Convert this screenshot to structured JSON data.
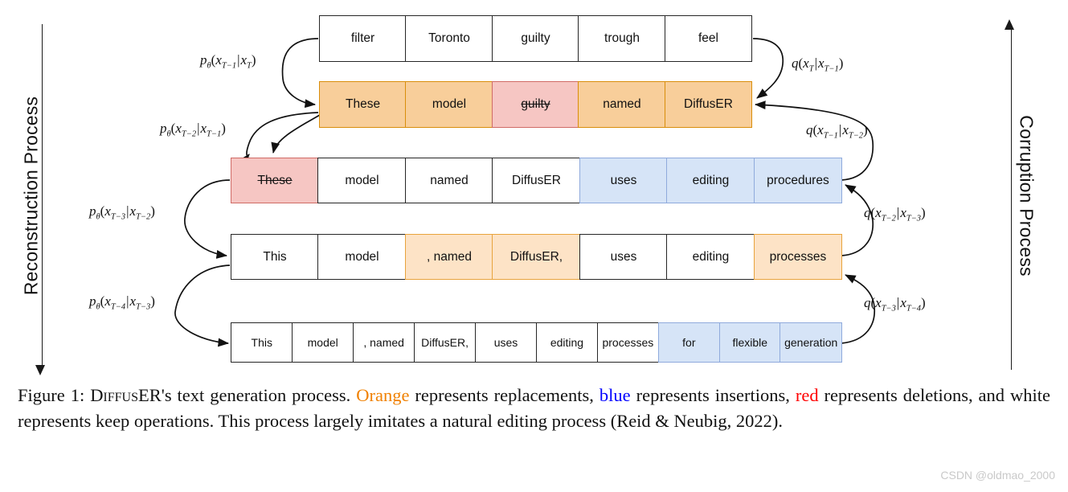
{
  "axes": {
    "left": {
      "label": "Reconstruction Process",
      "direction": "down"
    },
    "right": {
      "label": "Corruption Process",
      "direction": "up"
    }
  },
  "rows": [
    {
      "id": "row-1",
      "cells": [
        {
          "text": "filter",
          "style": "white",
          "strike": false
        },
        {
          "text": "Toronto",
          "style": "white",
          "strike": false
        },
        {
          "text": "guilty",
          "style": "white",
          "strike": false
        },
        {
          "text": "trough",
          "style": "white",
          "strike": false
        },
        {
          "text": "feel",
          "style": "white",
          "strike": false
        }
      ]
    },
    {
      "id": "row-2",
      "cells": [
        {
          "text": "These",
          "style": "orange",
          "strike": false
        },
        {
          "text": "model",
          "style": "orange",
          "strike": false
        },
        {
          "text": "guilty",
          "style": "red",
          "strike": true
        },
        {
          "text": "named",
          "style": "orange",
          "strike": false
        },
        {
          "text": "DiffusER",
          "style": "orange",
          "strike": false
        }
      ]
    },
    {
      "id": "row-3",
      "cells": [
        {
          "text": "These",
          "style": "red",
          "strike": true
        },
        {
          "text": "model",
          "style": "white",
          "strike": false
        },
        {
          "text": "named",
          "style": "white",
          "strike": false
        },
        {
          "text": "DiffusER",
          "style": "white",
          "strike": false
        },
        {
          "text": "uses",
          "style": "blue",
          "strike": false
        },
        {
          "text": "editing",
          "style": "blue",
          "strike": false
        },
        {
          "text": "procedures",
          "style": "blue",
          "strike": false
        }
      ]
    },
    {
      "id": "row-4",
      "cells": [
        {
          "text": "This",
          "style": "white",
          "strike": false
        },
        {
          "text": "model",
          "style": "white",
          "strike": false
        },
        {
          "text": ", named",
          "style": "orange-light",
          "strike": false
        },
        {
          "text": "DiffusER,",
          "style": "orange-light",
          "strike": false
        },
        {
          "text": "uses",
          "style": "white",
          "strike": false
        },
        {
          "text": "editing",
          "style": "white",
          "strike": false
        },
        {
          "text": "processes",
          "style": "orange-light",
          "strike": false
        }
      ]
    },
    {
      "id": "row-5",
      "cells": [
        {
          "text": "This",
          "style": "white",
          "strike": false
        },
        {
          "text": "model",
          "style": "white",
          "strike": false
        },
        {
          "text": ", named",
          "style": "white",
          "strike": false
        },
        {
          "text": "DiffusER,",
          "style": "white",
          "strike": false
        },
        {
          "text": "uses",
          "style": "white",
          "strike": false
        },
        {
          "text": "editing",
          "style": "white",
          "strike": false
        },
        {
          "text": "processes",
          "style": "white",
          "strike": false
        },
        {
          "text": "for",
          "style": "blue",
          "strike": false
        },
        {
          "text": "flexible",
          "style": "blue",
          "strike": false
        },
        {
          "text": "generation",
          "style": "blue",
          "strike": false
        }
      ]
    }
  ],
  "labels": {
    "reconstruction": [
      {
        "fn": "p",
        "sub_fn": "θ",
        "target": "x",
        "target_sub": "T−1",
        "cond": "x",
        "cond_sub": "T"
      },
      {
        "fn": "p",
        "sub_fn": "θ",
        "target": "x",
        "target_sub": "T−2",
        "cond": "x",
        "cond_sub": "T−1"
      },
      {
        "fn": "p",
        "sub_fn": "θ",
        "target": "x",
        "target_sub": "T−3",
        "cond": "x",
        "cond_sub": "T−2"
      },
      {
        "fn": "p",
        "sub_fn": "θ",
        "target": "x",
        "target_sub": "T−4",
        "cond": "x",
        "cond_sub": "T−3"
      }
    ],
    "corruption": [
      {
        "fn": "q",
        "sub_fn": "",
        "target": "x",
        "target_sub": "T",
        "cond": "x",
        "cond_sub": "T−1"
      },
      {
        "fn": "q",
        "sub_fn": "",
        "target": "x",
        "target_sub": "T−1",
        "cond": "x",
        "cond_sub": "T−2"
      },
      {
        "fn": "q",
        "sub_fn": "",
        "target": "x",
        "target_sub": "T−2",
        "cond": "x",
        "cond_sub": "T−3"
      },
      {
        "fn": "q",
        "sub_fn": "",
        "target": "x",
        "target_sub": "T−3",
        "cond": "x",
        "cond_sub": "T−4"
      }
    ]
  },
  "caption": {
    "prefix": "Figure 1: ",
    "model_name_small_caps": "DiffusER",
    "part1": "'s text generation process. ",
    "orange_word": "Orange",
    "part2": " represents replacements, ",
    "blue_word": "blue",
    "part3": " represents insertions, ",
    "red_word": "red",
    "part4": " represents deletions, and white represents keep operations. This process largely imitates a natural editing process (Reid & Neubig, 2022)."
  },
  "watermark": "CSDN @oldmao_2000",
  "colors": {
    "orange": "#f08000",
    "blue": "#0000ff",
    "red": "#ff0000",
    "cell_orange_fill": "#f8ce9a",
    "cell_orange_light_fill": "#fde3c6",
    "cell_blue_fill": "#d6e4f7",
    "cell_red_fill": "#f6c6c3"
  }
}
